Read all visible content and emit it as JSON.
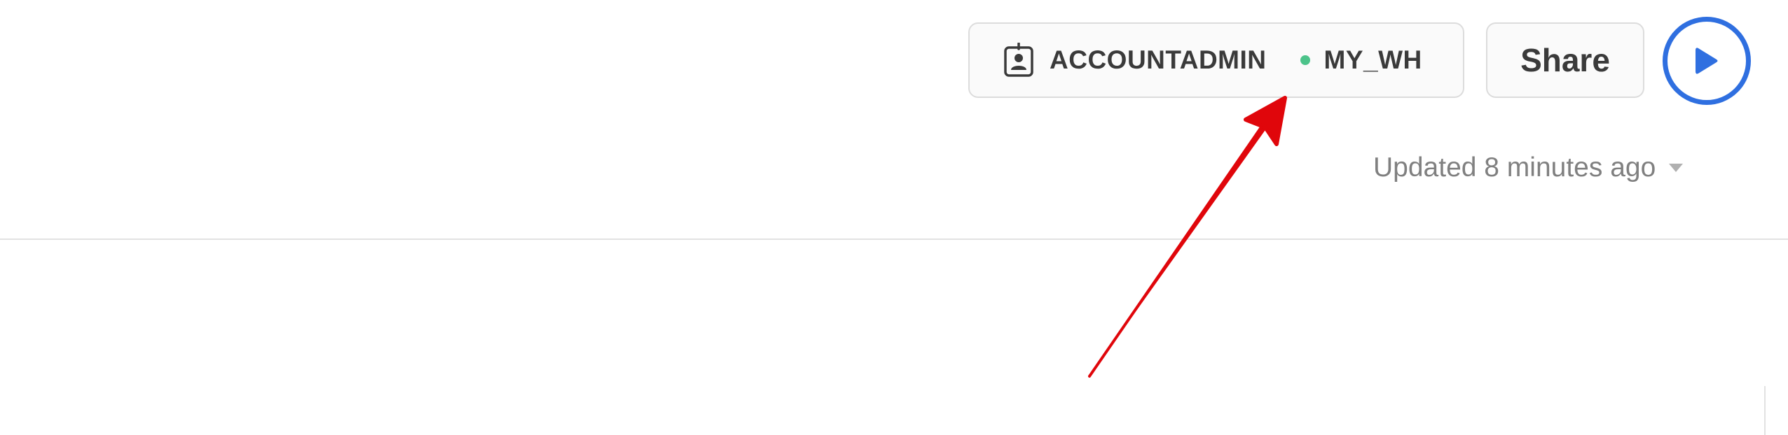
{
  "header": {
    "role": "ACCOUNTADMIN",
    "warehouse": "MY_WH",
    "warehouse_status_color": "#4cc38a",
    "share_label": "Share",
    "run_icon": "play-icon",
    "run_accent": "#2f6fe0"
  },
  "status": {
    "updated_text": "Updated 8 minutes ago"
  },
  "annotation": {
    "arrow_color": "#e0060b"
  }
}
